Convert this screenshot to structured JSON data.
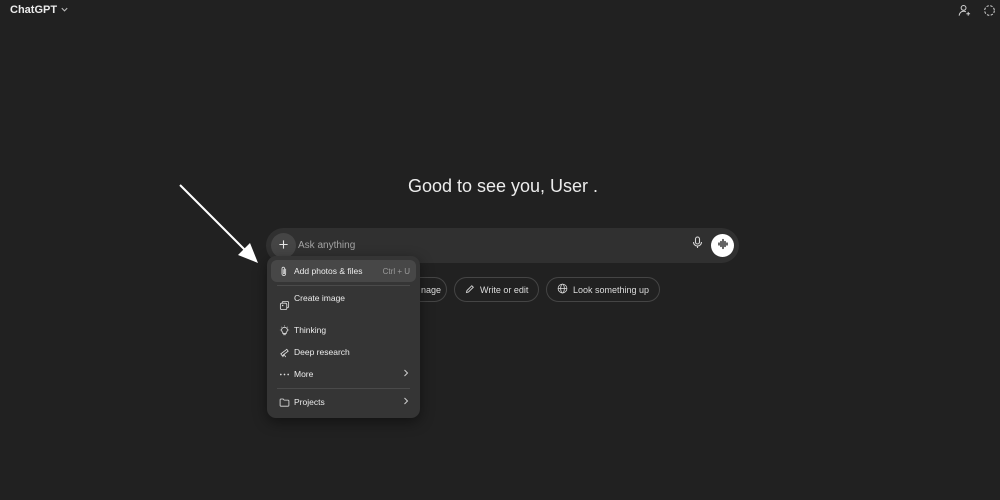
{
  "header": {
    "model_name": "ChatGPT",
    "icons": [
      "chevron-down-icon",
      "add-person-icon",
      "dashed-circle-icon"
    ]
  },
  "greeting": "Good to see you, User .",
  "composer": {
    "placeholder": "Ask anything",
    "value": ""
  },
  "chips": {
    "create_image_partial": "nage",
    "write_or_edit": "Write or edit",
    "look_something_up": "Look something up"
  },
  "menu": {
    "items": [
      {
        "label": "Add photos & files",
        "shortcut": "Ctrl + U",
        "icon": "paperclip-icon"
      },
      {
        "label": "Create image",
        "icon": "image-icon"
      },
      {
        "label": "Thinking",
        "icon": "lightbulb-icon"
      },
      {
        "label": "Deep research",
        "icon": "telescope-icon"
      },
      {
        "label": "More",
        "icon": "ellipsis-icon"
      },
      {
        "label": "Projects",
        "icon": "folder-icon"
      }
    ]
  },
  "colors": {
    "background": "#212121",
    "composer": "#303030",
    "menu": "#353535",
    "menu_active": "#474747",
    "text": "#ececec",
    "muted": "#a4a4a4",
    "annotation_arrow": "#ffffff"
  }
}
